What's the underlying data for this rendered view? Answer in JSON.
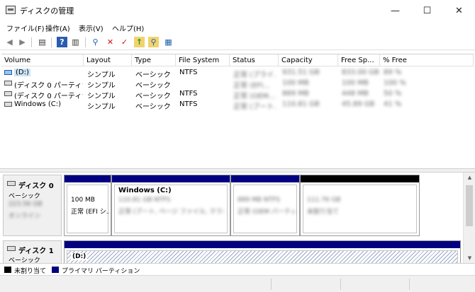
{
  "window": {
    "title": "ディスクの管理",
    "icon": "disk-management-icon",
    "minimize_glyph": "—",
    "maximize_glyph": "☐",
    "close_glyph": "✕"
  },
  "menu": [
    {
      "label": "ファイル(F)"
    },
    {
      "label": "操作(A)"
    },
    {
      "label": "表示(V)"
    },
    {
      "label": "ヘルプ(H)"
    }
  ],
  "toolbar": [
    {
      "name": "back-icon",
      "glyph": "◀"
    },
    {
      "name": "forward-icon",
      "glyph": "▶"
    },
    {
      "name": "console-tree-icon",
      "glyph": "▤"
    },
    {
      "name": "help-icon",
      "glyph": "?"
    },
    {
      "name": "view-icon",
      "glyph": "▥"
    },
    {
      "name": "connect-drive-icon",
      "glyph": "⚲"
    },
    {
      "name": "delete-icon",
      "glyph": "✕"
    },
    {
      "name": "check-icon",
      "glyph": "✓"
    },
    {
      "name": "move-up-icon",
      "glyph": "↑"
    },
    {
      "name": "search-icon",
      "glyph": "⚲"
    },
    {
      "name": "properties-icon",
      "glyph": "▦"
    }
  ],
  "volume_table": {
    "columns": [
      "Volume",
      "Layout",
      "Type",
      "File System",
      "Status",
      "Capacity",
      "Free Sp...",
      "% Free"
    ],
    "rows": [
      {
        "volume": "(D:)",
        "layout": "シンプル",
        "type": "ベーシック",
        "fs": "NTFS",
        "status": "正常 (プライ...",
        "capacity": "931.51 GB",
        "free": "833.00 GB",
        "pct": "89 %",
        "selected": true
      },
      {
        "volume": "(ディスク 0 パーティショ...",
        "layout": "シンプル",
        "type": "ベーシック",
        "fs": "",
        "status": "正常 (EFI...",
        "capacity": "100 MB",
        "free": "100 MB",
        "pct": "100 %",
        "selected": false
      },
      {
        "volume": "(ディスク 0 パーティショ...",
        "layout": "シンプル",
        "type": "ベーシック",
        "fs": "NTFS",
        "status": "正常 (OEM...",
        "capacity": "889 MB",
        "free": "448 MB",
        "pct": "50 %",
        "selected": false
      },
      {
        "volume": "Windows (C:)",
        "layout": "シンプル",
        "type": "ベーシック",
        "fs": "NTFS",
        "status": "正常 (ブート...",
        "capacity": "110.81 GB",
        "free": "45.89 GB",
        "pct": "41 %",
        "selected": false
      }
    ]
  },
  "disks": [
    {
      "name": "ディスク 0",
      "type": "ベーシック",
      "size": "223.56 GB",
      "state": "オンライン",
      "partitions": [
        {
          "title": "",
          "line1": "100 MB",
          "line2": "正常 (EFI シ..."
        },
        {
          "title": "Windows (C:)",
          "line1": "110.81 GB NTFS",
          "line2": "正常 (ブート, ページ ファイル, クラッシュ..."
        },
        {
          "title": "",
          "line1": "889 MB NTFS",
          "line2": "正常 (OEM パーティ..."
        },
        {
          "title": "",
          "line1": "111.76 GB",
          "line2": "未割り当て"
        }
      ]
    },
    {
      "name": "ディスク 1",
      "type": "ベーシック",
      "partitions": [
        {
          "title": "(D:)"
        }
      ]
    }
  ],
  "legend": [
    {
      "label": "未割り当て",
      "color": "#000000"
    },
    {
      "label": "プライマリ パーティション",
      "color": "#000080"
    }
  ],
  "colors": {
    "primary_partition": "#000080",
    "unallocated": "#000000",
    "selection": "#cce4f7",
    "hatch": "#9aa7c7"
  },
  "scrollbar": {
    "up_glyph": "▲",
    "down_glyph": "▼"
  }
}
